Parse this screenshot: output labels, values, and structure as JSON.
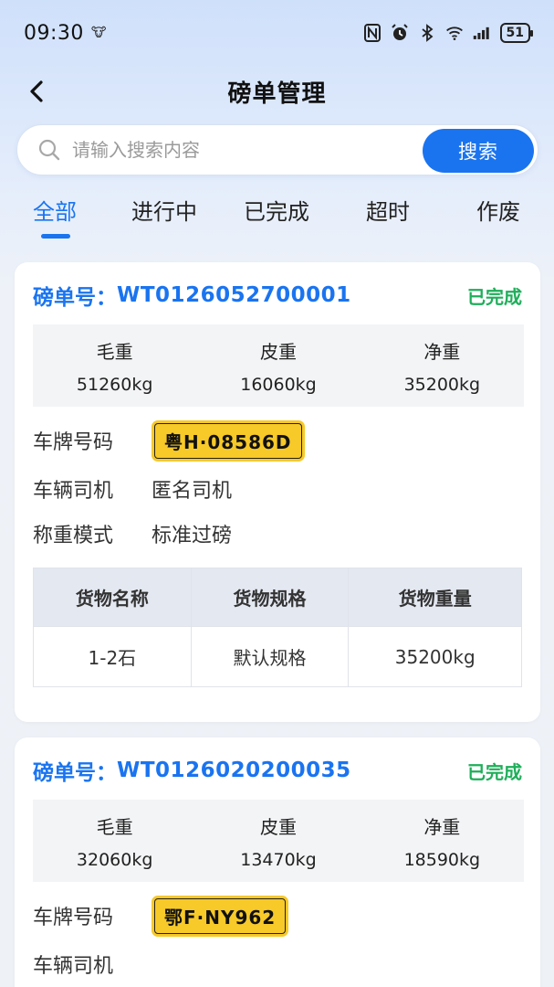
{
  "status": {
    "time": "09:30",
    "battery": "51",
    "icons": [
      "nfc-icon",
      "alarm-icon",
      "bluetooth-icon",
      "wifi-icon",
      "signal-icon"
    ]
  },
  "nav": {
    "title": "磅单管理",
    "back_icon": "chevron-left-icon"
  },
  "search": {
    "placeholder": "请输入搜索内容",
    "button_label": "搜索"
  },
  "tabs": [
    {
      "label": "全部",
      "active": true
    },
    {
      "label": "进行中",
      "active": false
    },
    {
      "label": "已完成",
      "active": false
    },
    {
      "label": "超时",
      "active": false
    },
    {
      "label": "作废",
      "active": false
    }
  ],
  "labels": {
    "order_prefix": "磅单号：",
    "gross": "毛重",
    "tare": "皮重",
    "net": "净重",
    "plate": "车牌号码",
    "driver": "车辆司机",
    "mode": "称重模式",
    "goods_headers": [
      "货物名称",
      "货物规格",
      "货物重量"
    ]
  },
  "orders": [
    {
      "order_no": "WT0126052700001",
      "status": "已完成",
      "gross": "51260kg",
      "tare": "16060kg",
      "net": "35200kg",
      "plate": "粤H·08586D",
      "driver": "匿名司机",
      "mode": "标准过磅",
      "goods": [
        {
          "name": "1-2石",
          "spec": "默认规格",
          "weight": "35200kg"
        }
      ]
    },
    {
      "order_no": "WT0126020200035",
      "status": "已完成",
      "gross": "32060kg",
      "tare": "13470kg",
      "net": "18590kg",
      "plate": "鄂F·NY962"
    }
  ],
  "colors": {
    "accent": "#1a74f0",
    "success": "#1fae5a",
    "plate": "#f7c929"
  }
}
